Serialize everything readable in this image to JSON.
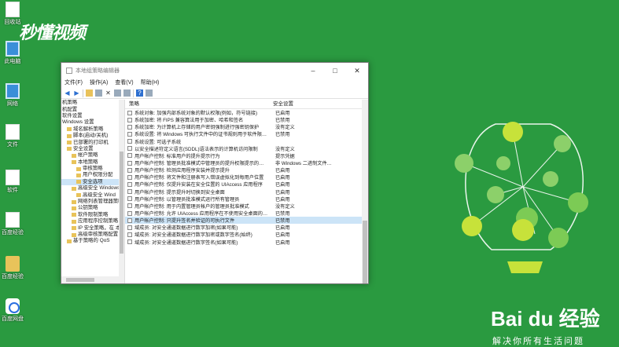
{
  "desktop": {
    "watermark": "秒懂视频",
    "icons": [
      {
        "label": "回收站",
        "icon": "recycle-bin-icon"
      },
      {
        "label": "此电脑",
        "icon": "computer-icon"
      },
      {
        "label": "网络",
        "icon": "network-icon"
      },
      {
        "label": "文件",
        "icon": "file-icon"
      },
      {
        "label": "软件",
        "icon": "file-icon"
      },
      {
        "label": "百度经验",
        "icon": "file-icon"
      },
      {
        "label": "百度经验",
        "icon": "folder-icon"
      },
      {
        "label": "百度网盘",
        "icon": "baidu-netdisk-icon"
      }
    ]
  },
  "window": {
    "title": "本地组策略编辑器",
    "menu": [
      "文件(F)",
      "操作(A)",
      "查看(V)",
      "帮助(H)"
    ],
    "tree": [
      {
        "label": "机策略",
        "icon": false,
        "indent": 0
      },
      {
        "label": "机配置",
        "icon": false,
        "indent": 0
      },
      {
        "label": "软件设置",
        "icon": false,
        "indent": 0
      },
      {
        "label": "Windows 设置",
        "icon": false,
        "indent": 0
      },
      {
        "label": "域名解析策略",
        "icon": true,
        "indent": 1
      },
      {
        "label": "脚本(启动/关机)",
        "icon": true,
        "indent": 1
      },
      {
        "label": "已部署的打印机",
        "icon": true,
        "indent": 1
      },
      {
        "label": "安全设置",
        "icon": true,
        "indent": 1
      },
      {
        "label": "帐户策略",
        "icon": true,
        "indent": 2
      },
      {
        "label": "本地策略",
        "icon": true,
        "indent": 2
      },
      {
        "label": "审核策略",
        "icon": true,
        "indent": 3
      },
      {
        "label": "用户权限分配",
        "icon": true,
        "indent": 3
      },
      {
        "label": "安全选项",
        "icon": true,
        "indent": 3,
        "selected": true
      },
      {
        "label": "高级安全 Windows",
        "icon": true,
        "indent": 2
      },
      {
        "label": "高级安全 Wind",
        "icon": true,
        "indent": 3
      },
      {
        "label": "网络列表管理器策略",
        "icon": true,
        "indent": 2
      },
      {
        "label": "公钥策略",
        "icon": true,
        "indent": 2
      },
      {
        "label": "软件限制策略",
        "icon": true,
        "indent": 2
      },
      {
        "label": "应用程序控制策略",
        "icon": true,
        "indent": 2
      },
      {
        "label": "IP 安全策略，在 本",
        "icon": true,
        "indent": 2
      },
      {
        "label": "高级审核策略配置",
        "icon": true,
        "indent": 2
      },
      {
        "label": "基于策略的 QoS",
        "icon": true,
        "indent": 1
      }
    ],
    "columns": {
      "policy": "策略",
      "setting": "安全设置"
    },
    "rows": [
      {
        "policy": "系统对象: 加强内部系统对象的默认权限(例如，符号链接)",
        "setting": "已启用"
      },
      {
        "policy": "系统加密: 将 FIPS 兼容算法用于加密、哈希和签名",
        "setting": "已禁用"
      },
      {
        "policy": "系统加密: 为计算机上存储的用户密钥强制进行强密钥保护",
        "setting": "没有定义"
      },
      {
        "policy": "系统设置: 将 Windows 可执行文件中的证书规则用于软件限…",
        "setting": "已禁用"
      },
      {
        "policy": "系统设置: 可选子系统",
        "setting": ""
      },
      {
        "policy": "以安全描述符定义语言(SDDL)语法表示的计算机访问限制",
        "setting": "没有定义"
      },
      {
        "policy": "用户帐户控制: 标准用户的提升提示行为",
        "setting": "提示凭据"
      },
      {
        "policy": "用户帐户控制: 管理员批准模式中管理员的提升权限提示的…",
        "setting": "非 Windows 二进制文件…"
      },
      {
        "policy": "用户帐户控制: 检测应用程序安装并提示提升",
        "setting": "已启用"
      },
      {
        "policy": "用户帐户控制: 将文件和注册表写入错误虚拟化到每用户位置",
        "setting": "已启用"
      },
      {
        "policy": "用户帐户控制: 仅提升安装在安全位置的 UIAccess 应用程序",
        "setting": "已启用"
      },
      {
        "policy": "用户帐户控制: 提示提升时切换到安全桌面",
        "setting": "已启用"
      },
      {
        "policy": "用户帐户控制: 以管理员批准模式运行所有管理员",
        "setting": "已启用"
      },
      {
        "policy": "用户帐户控制: 用于内置管理员帐户的管理员批准模式",
        "setting": "没有定义"
      },
      {
        "policy": "用户帐户控制: 允许 UIAccess 应用程序在不使用安全桌面的…",
        "setting": "已禁用"
      },
      {
        "policy": "用户帐户控制: 只提升签名并验证的可执行文件",
        "setting": "已禁用",
        "selected": true
      },
      {
        "policy": "域成员: 对安全通道数据进行数字加密(如果可能)",
        "setting": "已启用"
      },
      {
        "policy": "域成员: 对安全通道数据进行数字加密或数字签名(始终)",
        "setting": "已启用"
      },
      {
        "policy": "域成员: 对安全通道数据进行数字签名(如果可能)",
        "setting": "已启用"
      }
    ]
  },
  "branding": {
    "logo": "Bai du 经验",
    "slogan": "解决你所有生活问题"
  }
}
